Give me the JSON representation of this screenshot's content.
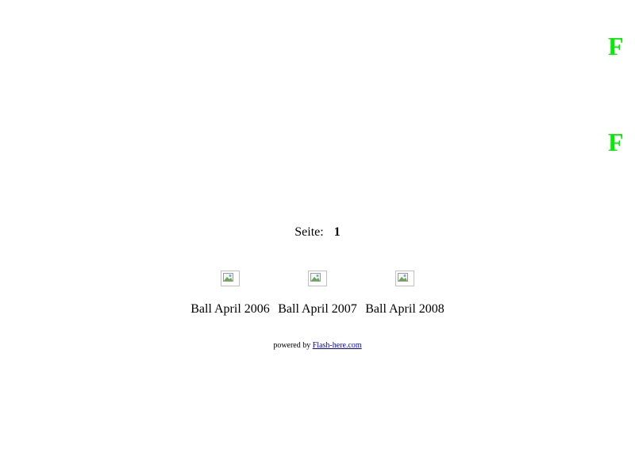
{
  "side_marks": {
    "top": "F",
    "bottom": "F",
    "color": "#00ee00"
  },
  "pager": {
    "label": "Seite:",
    "current": "1"
  },
  "gallery": [
    {
      "caption": "Ball April 2006",
      "icon": "broken-image-icon"
    },
    {
      "caption": "Ball April 2007",
      "icon": "broken-image-icon"
    },
    {
      "caption": "Ball April 2008",
      "icon": "broken-image-icon"
    }
  ],
  "footer": {
    "prefix": "powered by",
    "link_text": "Flash-here.com",
    "link_color": "#0000ee"
  }
}
